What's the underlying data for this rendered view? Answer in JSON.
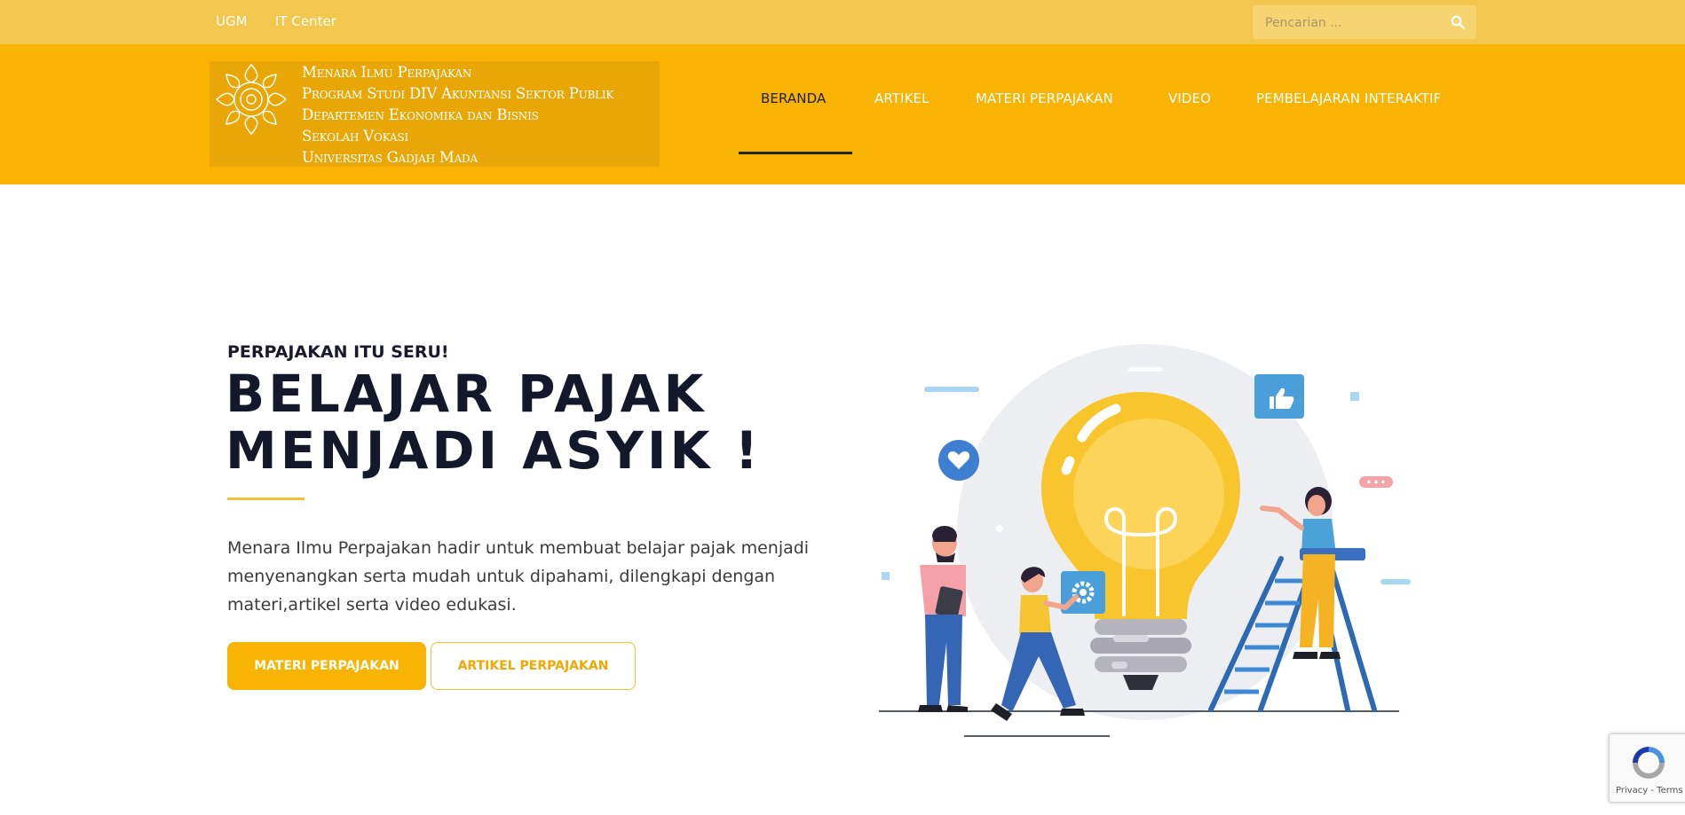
{
  "topbar": {
    "links": [
      "UGM",
      "IT Center"
    ],
    "search_placeholder": "Pencarian ..."
  },
  "header": {
    "logo_lines": [
      "Menara Ilmu Perpajakan",
      "Program Studi DIV Akuntansi Sektor Publik",
      "Departemen Ekonomika dan Bisnis",
      "Sekolah Vokasi",
      "Universitas Gadjah Mada"
    ],
    "nav": [
      "BERANDA",
      "ARTIKEL",
      "MATERI PERPAJAKAN",
      "VIDEO",
      "PEMBELAJARAN INTERAKTIF"
    ],
    "active_nav": "BERANDA"
  },
  "hero": {
    "kicker": "PERPAJAKAN ITU SERU!",
    "title_line1": "BELAJAR PAJAK",
    "title_line2": "MENJADI ASYIK !",
    "description": "Menara Ilmu Perpajakan hadir untuk membuat belajar pajak menjadi menyenangkan serta mudah untuk dipahami, dilengkapi dengan materi,artikel serta video edukasi.",
    "primary_button": "MATERI PERPAJAKAN",
    "secondary_button": "ARTIKEL PERPAJAKAN"
  },
  "recaptcha": {
    "terms": "Privacy - Terms"
  },
  "colors": {
    "topbar": "#f3c74e",
    "header": "#f9b403",
    "accent": "#f1c033",
    "title": "#14182b"
  },
  "icons": [
    "search-icon",
    "ugm-emblem",
    "lightbulb-illustration",
    "recaptcha-icon"
  ]
}
